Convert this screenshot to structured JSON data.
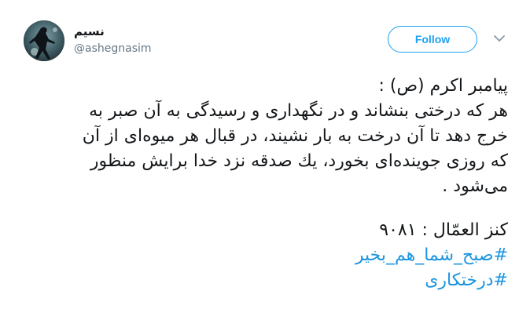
{
  "user": {
    "display_name": "نسیم",
    "handle": "@ashegnasim",
    "avatar": "silhouette-avatar"
  },
  "actions": {
    "follow_label": "Follow",
    "menu_icon": "chevron-down-icon"
  },
  "tweet": {
    "lines": [
      "پیامبر اکرم (ص) :",
      "هر که درختی بنشاند و در نگهداری و رسیدگی به آن صبر به",
      "خرج دهد تا آن درخت به بار نشیند، در قبال هر میوه‌ای از آن",
      "که روزی جوینده‌ای بخورد، یك صدقه نزد خدا برایش منظور",
      "می‌شود ."
    ],
    "source": "کنز العمّال : ۹۰۸۱",
    "hashtags": [
      "#صبح_شما_هم_بخیر",
      "#درختکاری"
    ]
  },
  "colors": {
    "accent": "#1da1f2",
    "hashtag": "#1b95e0",
    "text": "#14171a",
    "muted": "#657786"
  }
}
